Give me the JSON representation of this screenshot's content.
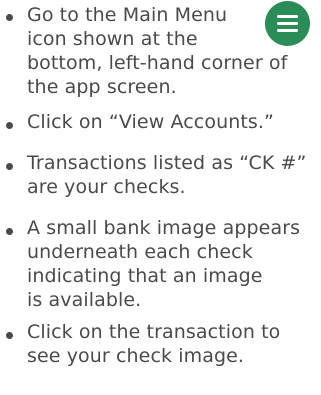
{
  "icons": {
    "menu_icon": "hamburger-menu-icon",
    "menu_icon_color": "#2a8c57"
  },
  "instructions": [
    {
      "lines": [
        "Go to the Main Menu",
        "icon shown at the",
        "bottom, left-hand corner of",
        "the app screen."
      ]
    },
    {
      "lines": [
        "Click on “View Accounts.”"
      ]
    },
    {
      "lines": [
        "Transactions listed as “CK #”",
        "are your checks."
      ]
    },
    {
      "lines": [
        "A small bank image appears",
        "underneath each check",
        "indicating that an image",
        "is available."
      ]
    },
    {
      "lines": [
        "Click on the transaction to",
        "see your check image."
      ]
    }
  ]
}
